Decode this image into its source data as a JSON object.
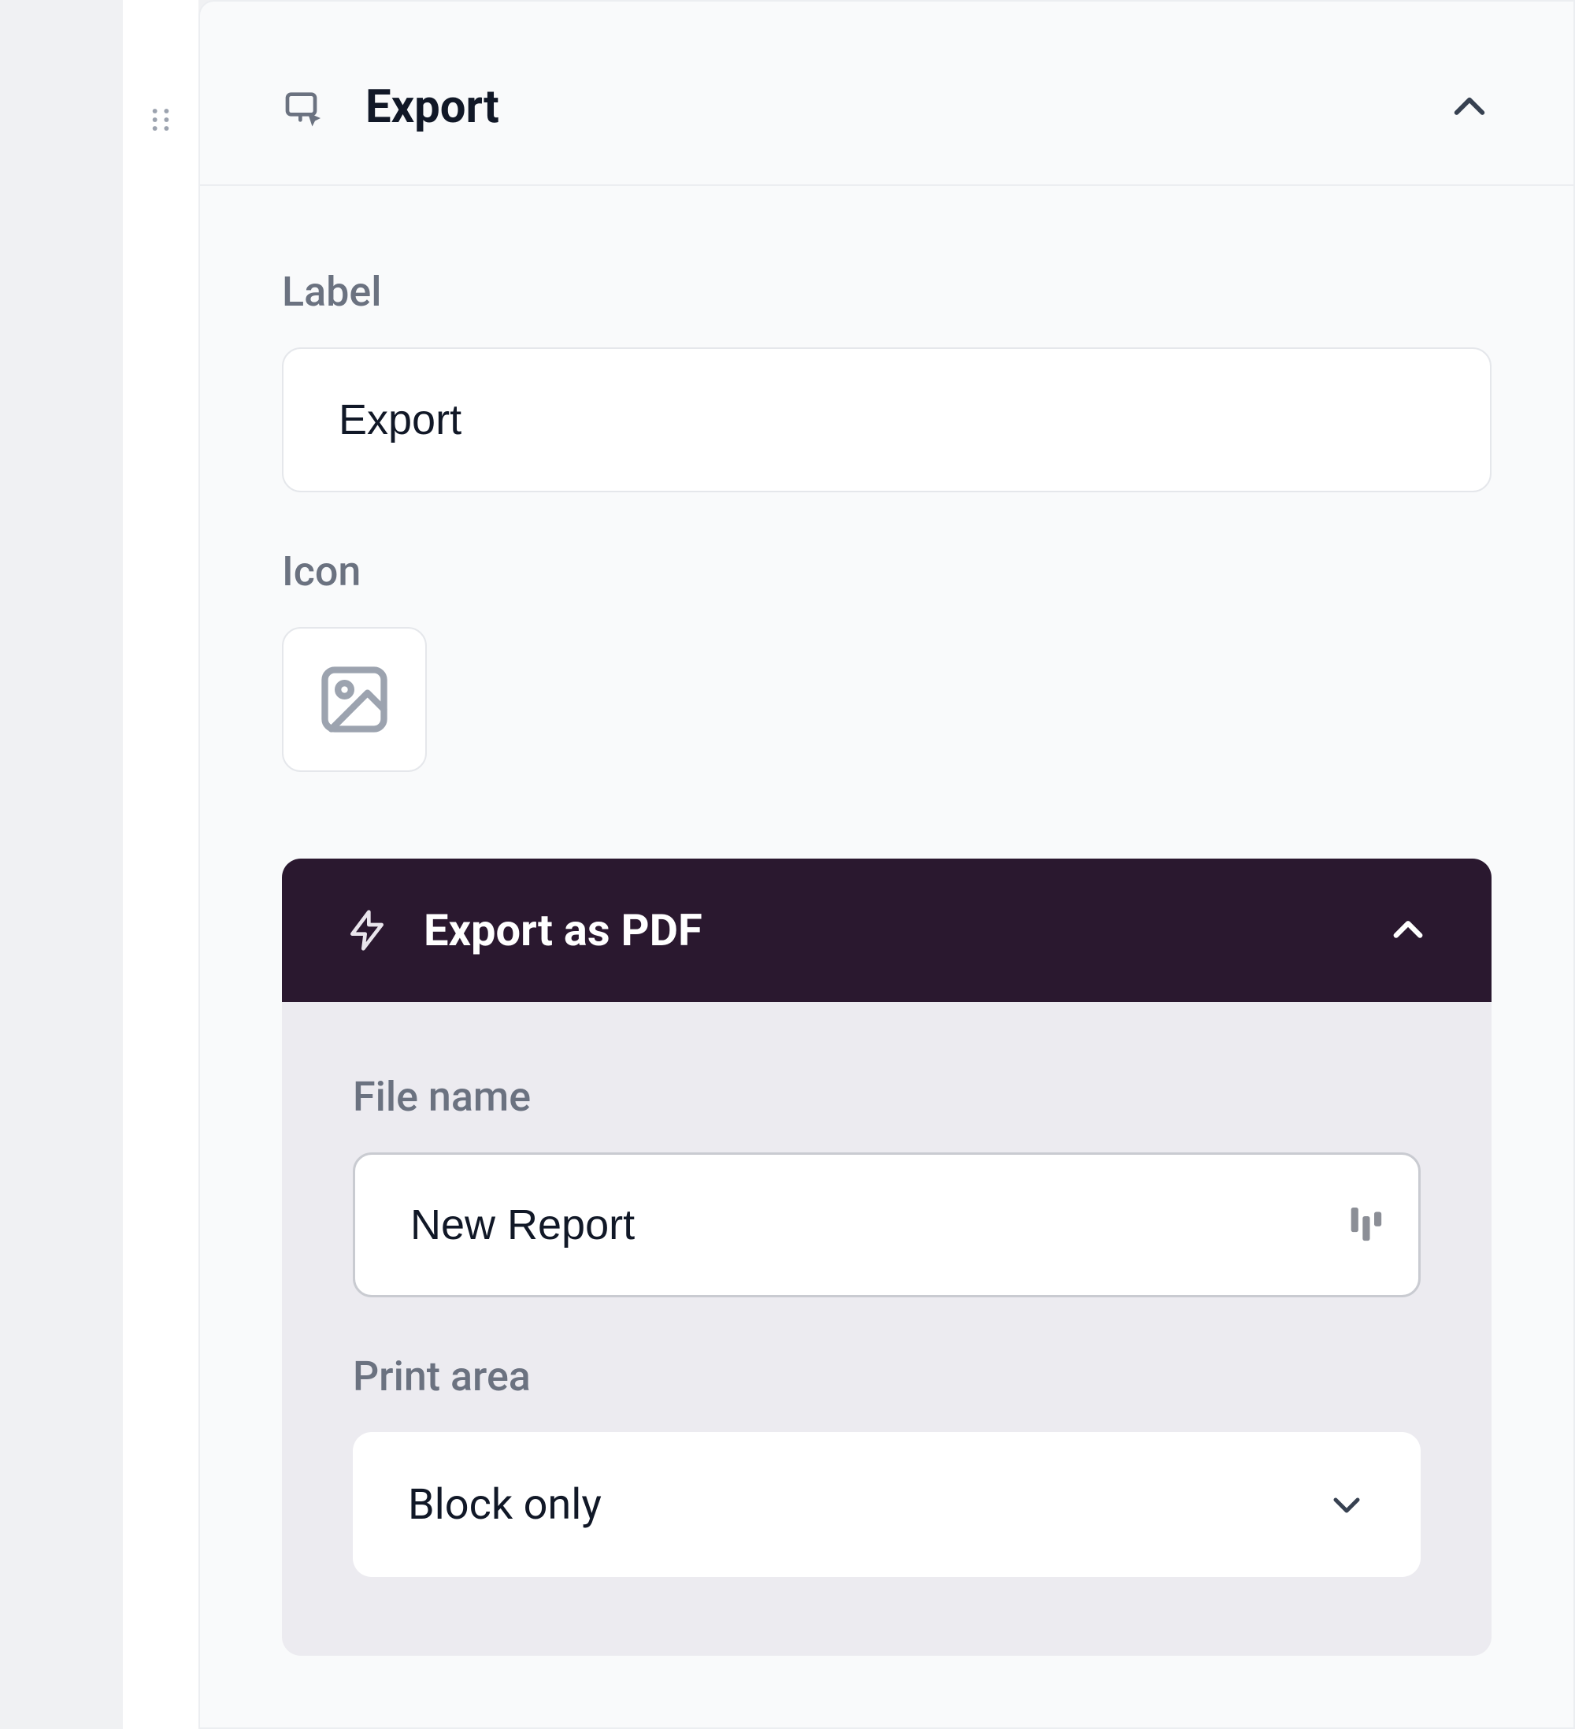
{
  "panel": {
    "title": "Export",
    "fields": {
      "label": {
        "title": "Label",
        "value": "Export"
      },
      "icon": {
        "title": "Icon"
      }
    }
  },
  "action": {
    "title": "Export as PDF",
    "fields": {
      "filename": {
        "title": "File name",
        "value": "New Report"
      },
      "print_area": {
        "title": "Print area",
        "value": "Block only"
      }
    }
  }
}
